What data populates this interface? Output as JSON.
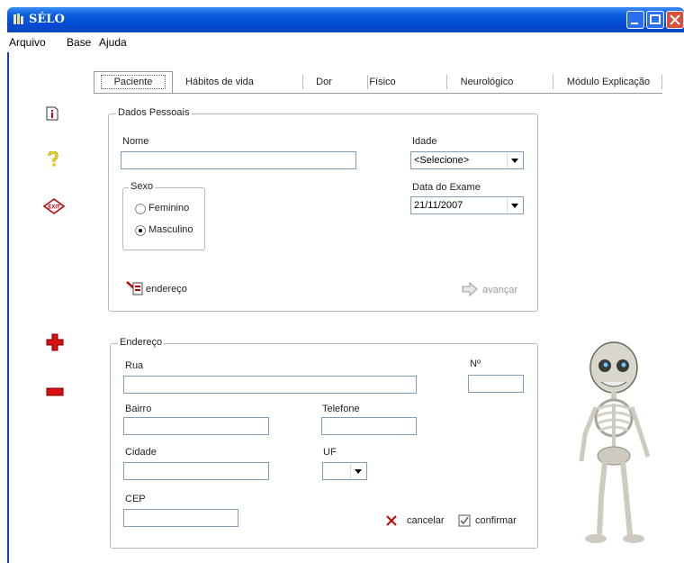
{
  "window": {
    "title": "SÉLO"
  },
  "menu": [
    {
      "label": "Arquivo"
    },
    {
      "label": "Base"
    },
    {
      "label": "Ajuda"
    }
  ],
  "tabs": [
    {
      "label": "Paciente",
      "active": true
    },
    {
      "label": "Hábitos de vida"
    },
    {
      "label": "Dor"
    },
    {
      "label": "Físico"
    },
    {
      "label": "Neurológico"
    },
    {
      "label": "Módulo Explicação"
    }
  ],
  "sidebar": [
    {
      "icon": "info-icon"
    },
    {
      "icon": "help-icon"
    },
    {
      "icon": "exit-icon"
    },
    {
      "icon": "add-icon"
    },
    {
      "icon": "remove-icon"
    }
  ],
  "dados_pessoais": {
    "title": "Dados Pessoais",
    "nome_label": "Nome",
    "nome_value": "",
    "idade_label": "Idade",
    "idade_value": "<Selecione>",
    "sexo": {
      "label": "Sexo",
      "options": [
        "Feminino",
        "Masculino"
      ],
      "selected": "Masculino"
    },
    "data_exame_label": "Data do Exame",
    "data_exame_value": "21/11/2007",
    "endereco_button": "endereço",
    "avancar_button": "avançar"
  },
  "endereco": {
    "title": "Endereço",
    "rua_label": "Rua",
    "numero_label": "Nº",
    "bairro_label": "Bairro",
    "telefone_label": "Telefone",
    "cidade_label": "Cidade",
    "uf_label": "UF",
    "uf_value": "",
    "cep_label": "CEP",
    "cancelar_button": "cancelar",
    "confirmar_button": "confirmar"
  },
  "colors": {
    "titlebar": "#0a5fe0",
    "accent_red": "#cc0000",
    "group_border": "#b8b8b8"
  }
}
